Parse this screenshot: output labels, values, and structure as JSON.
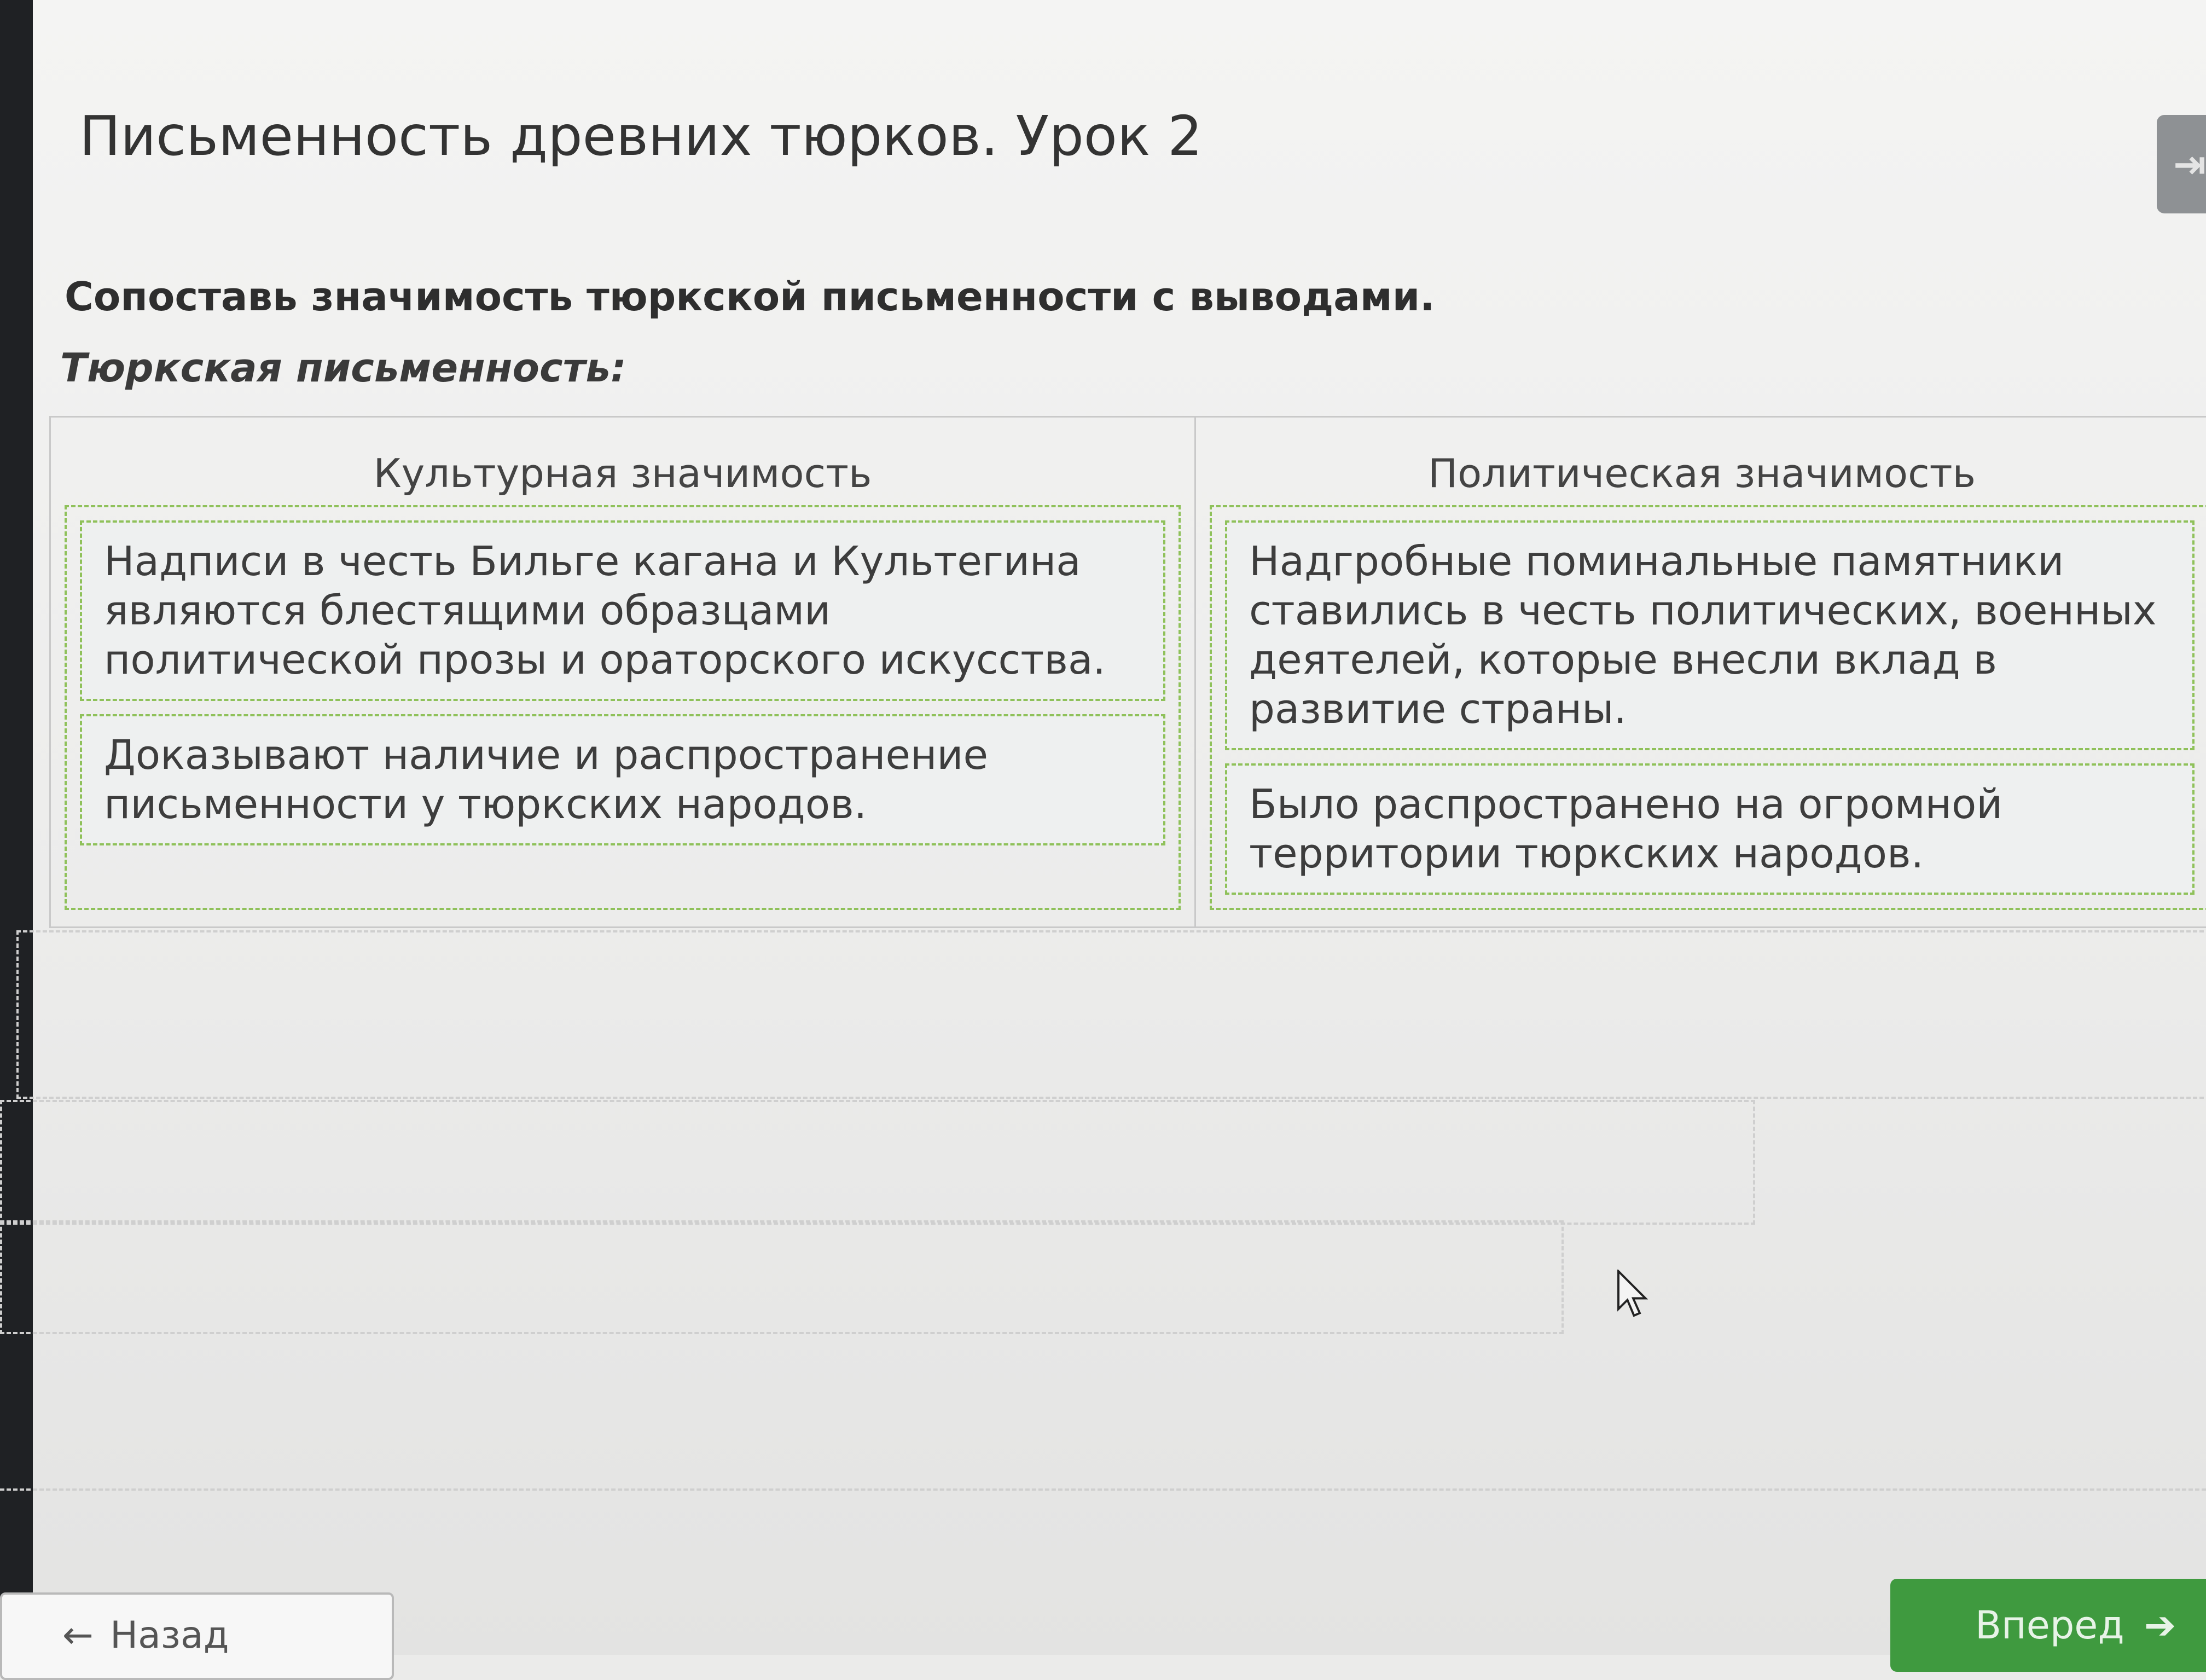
{
  "lesson": {
    "title": "Письменность древних тюрков. Урок 2",
    "instruction": "Сопоставь значимость тюркской письменности с выводами.",
    "subtitle": "Тюркская письменность:"
  },
  "columns": [
    {
      "header": "Культурная значимость",
      "cards": [
        "Надписи в честь Бильге кагана и Культегина являются блестящими образцами политической прозы и ораторского искусства.",
        "Доказывают наличие и распространение письменности у тюркских народов."
      ]
    },
    {
      "header": "Политическая значимость",
      "cards": [
        "Надгробные поминальные памятники ставились в честь политических, военных деятелей, которые внесли вклад в развитие страны.",
        "Было распространено на огромной территории тюркских народов."
      ]
    }
  ],
  "nav": {
    "back_label": "Назад",
    "back_icon": "arrow-left-icon",
    "next_label": "Вперед",
    "next_icon": "arrow-right-icon",
    "next_color": "#3f9a3f"
  },
  "colors": {
    "dashed_accent": "#8fc15a"
  }
}
